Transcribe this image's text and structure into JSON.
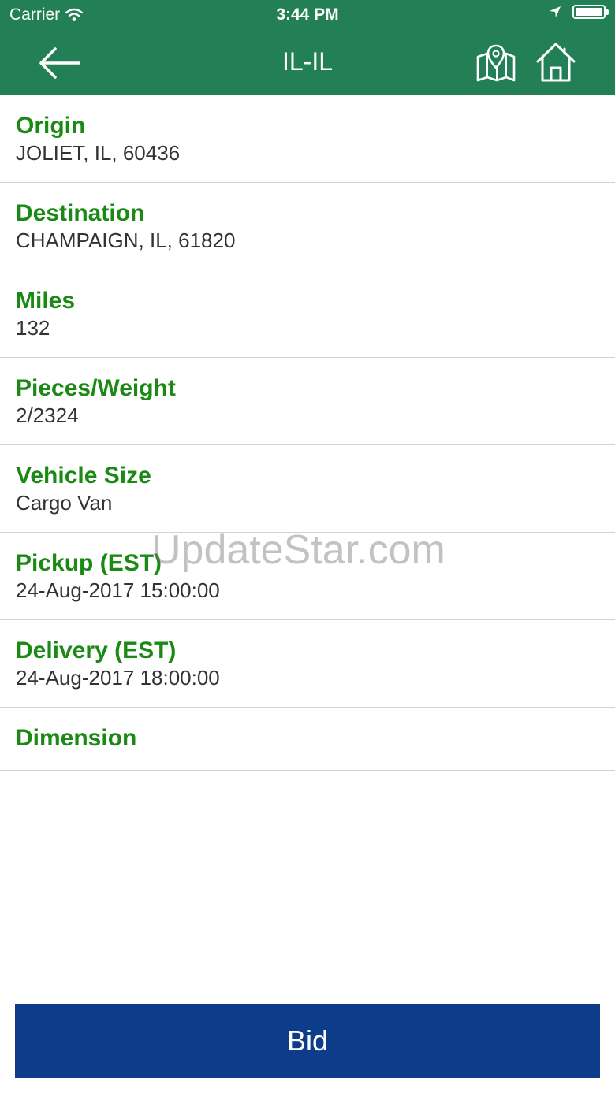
{
  "status_bar": {
    "carrier": "Carrier",
    "time": "3:44 PM"
  },
  "nav": {
    "title": "IL-IL",
    "icons": [
      "back-arrow-icon",
      "map-pin-icon",
      "home-icon"
    ]
  },
  "details": [
    {
      "label": "Origin",
      "value": "JOLIET, IL, 60436"
    },
    {
      "label": "Destination",
      "value": "CHAMPAIGN, IL, 61820"
    },
    {
      "label": "Miles",
      "value": "132"
    },
    {
      "label": "Pieces/Weight",
      "value": "2/2324"
    },
    {
      "label": "Vehicle Size",
      "value": "Cargo Van"
    },
    {
      "label": "Pickup (EST)",
      "value": "24-Aug-2017 15:00:00"
    },
    {
      "label": "Delivery (EST)",
      "value": "24-Aug-2017 18:00:00"
    },
    {
      "label": "Dimension",
      "value": ""
    }
  ],
  "watermark": "UpdateStar.com",
  "bid_label": "Bid",
  "colors": {
    "header": "#237f55",
    "label": "#1b8a15",
    "bid_button": "#0d3d8a"
  }
}
